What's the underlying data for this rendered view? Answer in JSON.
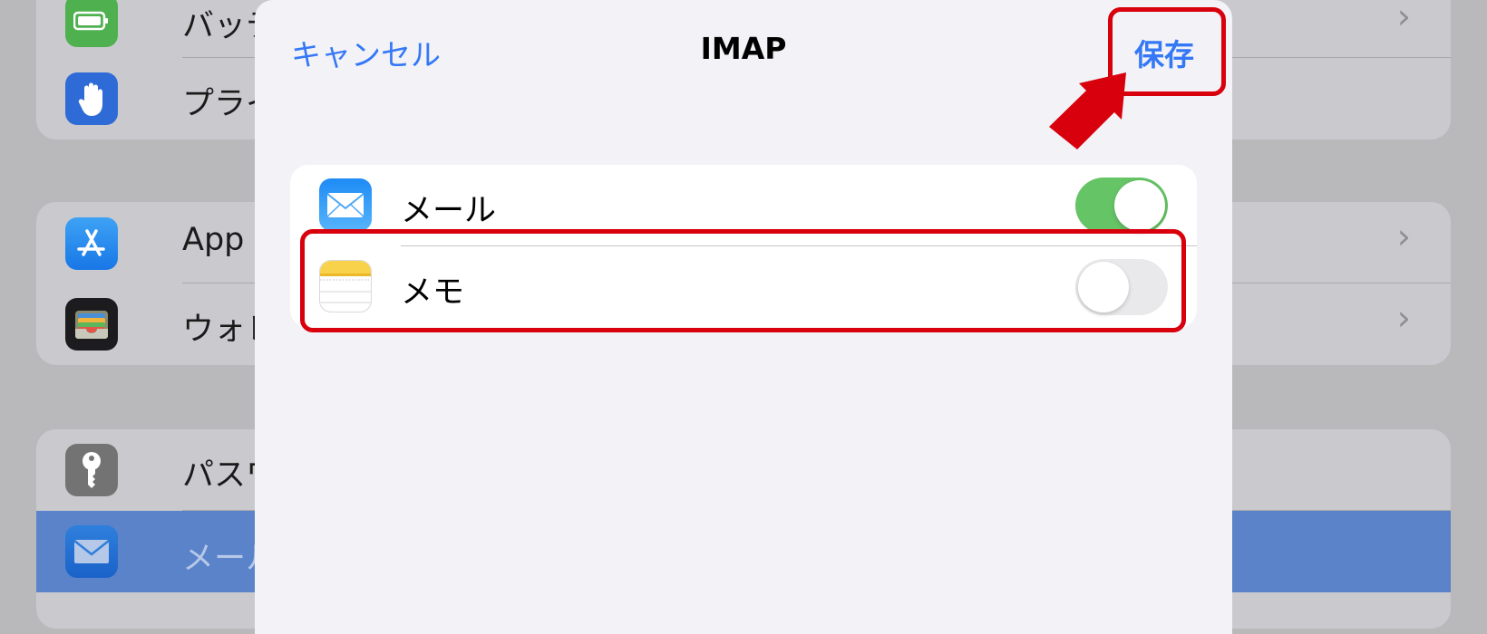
{
  "background": {
    "group1": [
      {
        "label": "バッテリー",
        "icon": "battery-icon"
      },
      {
        "label": "プライバシー",
        "icon": "privacy-hand-icon"
      }
    ],
    "group2": [
      {
        "label": "App Store",
        "icon": "app-store-icon"
      },
      {
        "label": "ウォレット",
        "icon": "wallet-icon"
      }
    ],
    "group3": [
      {
        "label": "パスワード",
        "icon": "key-icon"
      },
      {
        "label": "メール",
        "icon": "mail-icon",
        "selected": true
      }
    ]
  },
  "sheet": {
    "cancel_label": "キャンセル",
    "title": "IMAP",
    "save_label": "保存",
    "rows": [
      {
        "label": "メール",
        "icon": "mail-app-icon",
        "toggle_on": true
      },
      {
        "label": "メモ",
        "icon": "notes-app-icon",
        "toggle_on": false
      }
    ]
  },
  "colors": {
    "accent": "#3478f6",
    "toggle_on": "#65c466",
    "toggle_off": "#e9e9eb",
    "annotation": "#d8000c"
  }
}
